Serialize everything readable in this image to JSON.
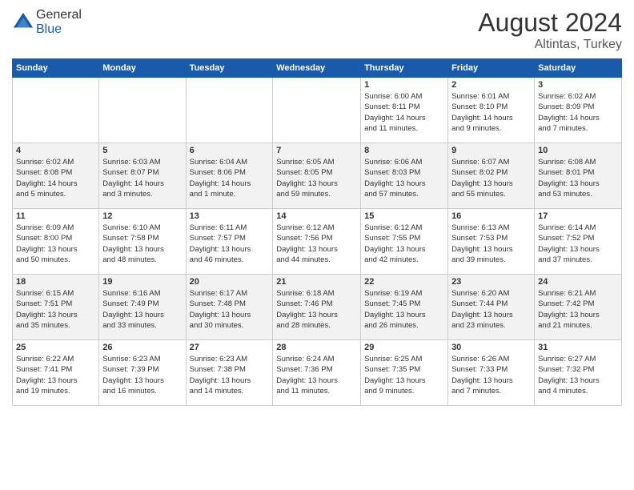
{
  "header": {
    "logo_general": "General",
    "logo_blue": "Blue",
    "month_year": "August 2024",
    "location": "Altintas, Turkey"
  },
  "calendar": {
    "days_of_week": [
      "Sunday",
      "Monday",
      "Tuesday",
      "Wednesday",
      "Thursday",
      "Friday",
      "Saturday"
    ],
    "weeks": [
      [
        {
          "day": "",
          "content": ""
        },
        {
          "day": "",
          "content": ""
        },
        {
          "day": "",
          "content": ""
        },
        {
          "day": "",
          "content": ""
        },
        {
          "day": "1",
          "content": "Sunrise: 6:00 AM\nSunset: 8:11 PM\nDaylight: 14 hours\nand 11 minutes."
        },
        {
          "day": "2",
          "content": "Sunrise: 6:01 AM\nSunset: 8:10 PM\nDaylight: 14 hours\nand 9 minutes."
        },
        {
          "day": "3",
          "content": "Sunrise: 6:02 AM\nSunset: 8:09 PM\nDaylight: 14 hours\nand 7 minutes."
        }
      ],
      [
        {
          "day": "4",
          "content": "Sunrise: 6:02 AM\nSunset: 8:08 PM\nDaylight: 14 hours\nand 5 minutes."
        },
        {
          "day": "5",
          "content": "Sunrise: 6:03 AM\nSunset: 8:07 PM\nDaylight: 14 hours\nand 3 minutes."
        },
        {
          "day": "6",
          "content": "Sunrise: 6:04 AM\nSunset: 8:06 PM\nDaylight: 14 hours\nand 1 minute."
        },
        {
          "day": "7",
          "content": "Sunrise: 6:05 AM\nSunset: 8:05 PM\nDaylight: 13 hours\nand 59 minutes."
        },
        {
          "day": "8",
          "content": "Sunrise: 6:06 AM\nSunset: 8:03 PM\nDaylight: 13 hours\nand 57 minutes."
        },
        {
          "day": "9",
          "content": "Sunrise: 6:07 AM\nSunset: 8:02 PM\nDaylight: 13 hours\nand 55 minutes."
        },
        {
          "day": "10",
          "content": "Sunrise: 6:08 AM\nSunset: 8:01 PM\nDaylight: 13 hours\nand 53 minutes."
        }
      ],
      [
        {
          "day": "11",
          "content": "Sunrise: 6:09 AM\nSunset: 8:00 PM\nDaylight: 13 hours\nand 50 minutes."
        },
        {
          "day": "12",
          "content": "Sunrise: 6:10 AM\nSunset: 7:58 PM\nDaylight: 13 hours\nand 48 minutes."
        },
        {
          "day": "13",
          "content": "Sunrise: 6:11 AM\nSunset: 7:57 PM\nDaylight: 13 hours\nand 46 minutes."
        },
        {
          "day": "14",
          "content": "Sunrise: 6:12 AM\nSunset: 7:56 PM\nDaylight: 13 hours\nand 44 minutes."
        },
        {
          "day": "15",
          "content": "Sunrise: 6:12 AM\nSunset: 7:55 PM\nDaylight: 13 hours\nand 42 minutes."
        },
        {
          "day": "16",
          "content": "Sunrise: 6:13 AM\nSunset: 7:53 PM\nDaylight: 13 hours\nand 39 minutes."
        },
        {
          "day": "17",
          "content": "Sunrise: 6:14 AM\nSunset: 7:52 PM\nDaylight: 13 hours\nand 37 minutes."
        }
      ],
      [
        {
          "day": "18",
          "content": "Sunrise: 6:15 AM\nSunset: 7:51 PM\nDaylight: 13 hours\nand 35 minutes."
        },
        {
          "day": "19",
          "content": "Sunrise: 6:16 AM\nSunset: 7:49 PM\nDaylight: 13 hours\nand 33 minutes."
        },
        {
          "day": "20",
          "content": "Sunrise: 6:17 AM\nSunset: 7:48 PM\nDaylight: 13 hours\nand 30 minutes."
        },
        {
          "day": "21",
          "content": "Sunrise: 6:18 AM\nSunset: 7:46 PM\nDaylight: 13 hours\nand 28 minutes."
        },
        {
          "day": "22",
          "content": "Sunrise: 6:19 AM\nSunset: 7:45 PM\nDaylight: 13 hours\nand 26 minutes."
        },
        {
          "day": "23",
          "content": "Sunrise: 6:20 AM\nSunset: 7:44 PM\nDaylight: 13 hours\nand 23 minutes."
        },
        {
          "day": "24",
          "content": "Sunrise: 6:21 AM\nSunset: 7:42 PM\nDaylight: 13 hours\nand 21 minutes."
        }
      ],
      [
        {
          "day": "25",
          "content": "Sunrise: 6:22 AM\nSunset: 7:41 PM\nDaylight: 13 hours\nand 19 minutes."
        },
        {
          "day": "26",
          "content": "Sunrise: 6:23 AM\nSunset: 7:39 PM\nDaylight: 13 hours\nand 16 minutes."
        },
        {
          "day": "27",
          "content": "Sunrise: 6:23 AM\nSunset: 7:38 PM\nDaylight: 13 hours\nand 14 minutes."
        },
        {
          "day": "28",
          "content": "Sunrise: 6:24 AM\nSunset: 7:36 PM\nDaylight: 13 hours\nand 11 minutes."
        },
        {
          "day": "29",
          "content": "Sunrise: 6:25 AM\nSunset: 7:35 PM\nDaylight: 13 hours\nand 9 minutes."
        },
        {
          "day": "30",
          "content": "Sunrise: 6:26 AM\nSunset: 7:33 PM\nDaylight: 13 hours\nand 7 minutes."
        },
        {
          "day": "31",
          "content": "Sunrise: 6:27 AM\nSunset: 7:32 PM\nDaylight: 13 hours\nand 4 minutes."
        }
      ]
    ]
  }
}
